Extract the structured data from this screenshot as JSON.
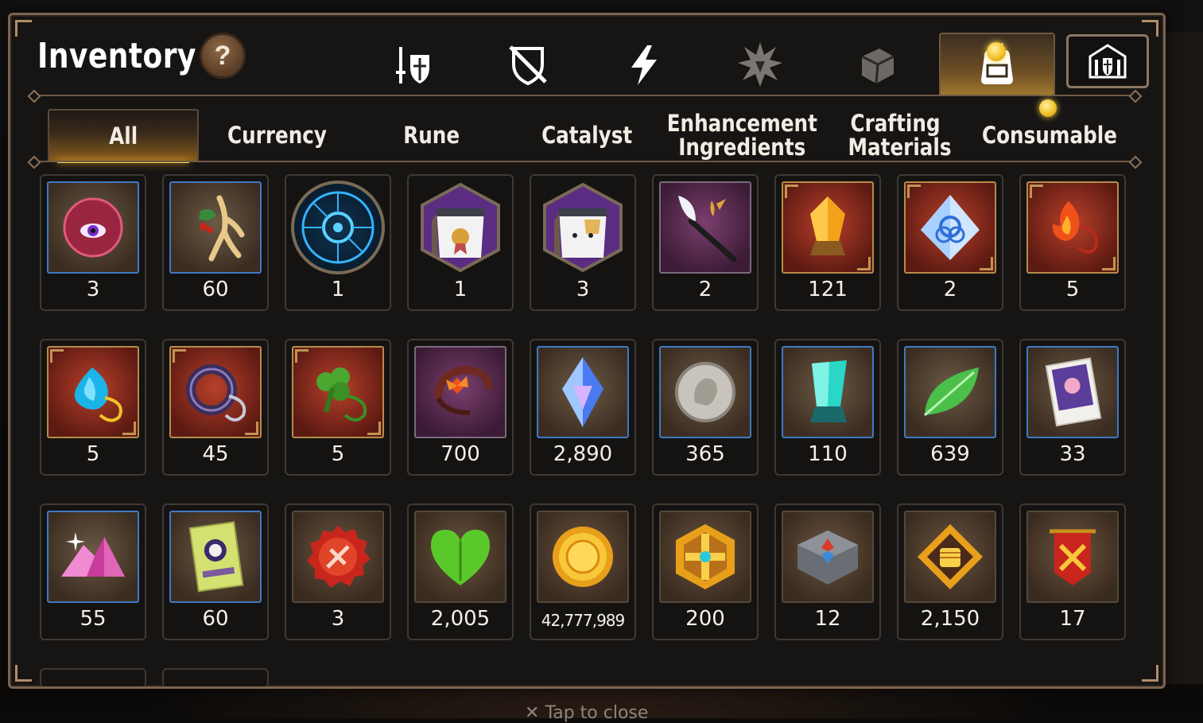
{
  "header": {
    "title": "Inventory",
    "help_label": "?"
  },
  "category_tabs": [
    {
      "icon": "sword-shield-icon"
    },
    {
      "icon": "crossed-shield-icon"
    },
    {
      "icon": "lightning-icon"
    },
    {
      "icon": "burst-emblem-icon"
    },
    {
      "icon": "cube-icon"
    },
    {
      "icon": "backpack-icon",
      "active": true,
      "notification": true
    },
    {
      "icon": "guild-castle-icon",
      "boxed": true
    }
  ],
  "filter_tabs": [
    {
      "label": "All",
      "active": true
    },
    {
      "label": "Currency"
    },
    {
      "label": "Rune"
    },
    {
      "label": "Catalyst"
    },
    {
      "label": "Enhancement Ingredients"
    },
    {
      "label": "Crafting Materials"
    },
    {
      "label": "Consumable",
      "notification": true
    }
  ],
  "items": [
    {
      "icon": "purple-eye-orb-icon",
      "count": "3"
    },
    {
      "icon": "golden-root-icon",
      "count": "60"
    },
    {
      "icon": "blue-rune-circle-icon",
      "count": "1"
    },
    {
      "icon": "pet-food-pack-ribbon-icon",
      "count": "1"
    },
    {
      "icon": "pet-food-pack-icon",
      "count": "3"
    },
    {
      "icon": "feather-wand-icon",
      "count": "2"
    },
    {
      "icon": "amber-crystal-icon",
      "count": "121"
    },
    {
      "icon": "triquetra-crystal-icon",
      "count": "2"
    },
    {
      "icon": "flame-pendant-icon",
      "count": "5"
    },
    {
      "icon": "water-drop-pendant-icon",
      "count": "5"
    },
    {
      "icon": "moon-ring-pendant-icon",
      "count": "45"
    },
    {
      "icon": "clover-pendant-icon",
      "count": "5"
    },
    {
      "icon": "flower-claw-icon",
      "count": "700"
    },
    {
      "icon": "blue-gem-icon",
      "count": "2,890"
    },
    {
      "icon": "silver-coin-icon",
      "count": "365"
    },
    {
      "icon": "teal-crystal-icon",
      "count": "110"
    },
    {
      "icon": "green-leaf-icon",
      "count": "639"
    },
    {
      "icon": "pet-card-icon",
      "count": "33"
    },
    {
      "icon": "pink-crystal-pile-icon",
      "count": "55"
    },
    {
      "icon": "green-card-icon",
      "count": "60"
    },
    {
      "icon": "red-badge-icon",
      "count": "3"
    },
    {
      "icon": "green-heart-icon",
      "count": "2,005"
    },
    {
      "icon": "gold-sun-coin-icon",
      "count": "42,777,989"
    },
    {
      "icon": "gold-hex-emblem-icon",
      "count": "200"
    },
    {
      "icon": "stone-compass-icon",
      "count": "12"
    },
    {
      "icon": "gold-fist-emblem-icon",
      "count": "2,150"
    },
    {
      "icon": "red-banner-icon",
      "count": "17"
    }
  ],
  "footer": {
    "hint": "Tap to close"
  },
  "colors": {
    "frame": "#7b6450",
    "accent_gold": "#f2c22a",
    "panel_bg": "#171513"
  }
}
